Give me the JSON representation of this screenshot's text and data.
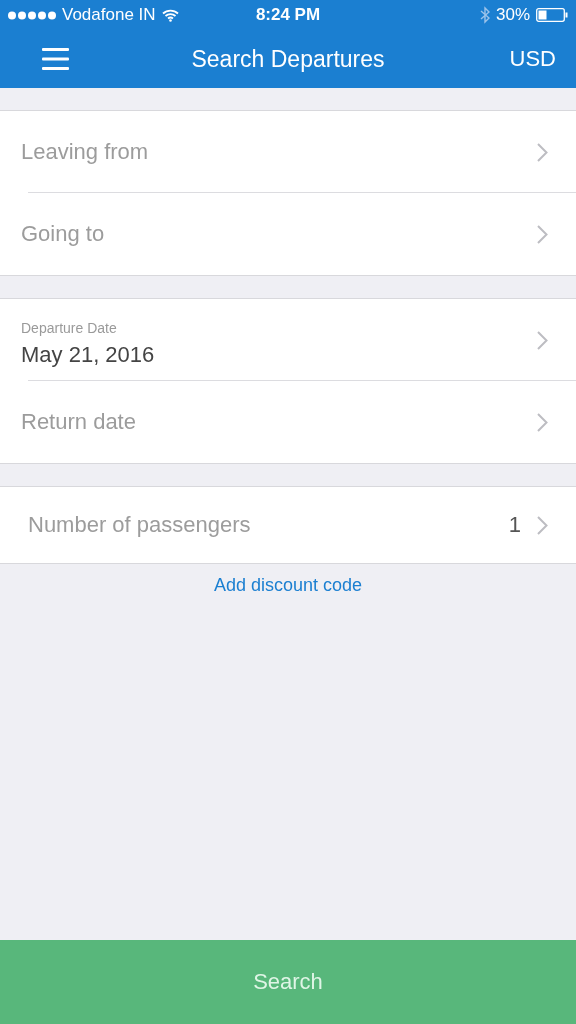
{
  "status_bar": {
    "carrier": "Vodafone IN",
    "time": "8:24 PM",
    "battery": "30%"
  },
  "nav": {
    "title": "Search Departures",
    "currency": "USD"
  },
  "groups": [
    {
      "rows": [
        {
          "kind": "placeholder",
          "text": "Leaving from"
        },
        {
          "kind": "placeholder",
          "text": "Going to"
        }
      ]
    },
    {
      "rows": [
        {
          "kind": "value",
          "label": "Departure Date",
          "text": "May 21, 2016"
        },
        {
          "kind": "placeholder",
          "text": "Return date"
        }
      ]
    },
    {
      "rows": [
        {
          "kind": "count",
          "text": "Number of passengers",
          "value": "1"
        }
      ]
    }
  ],
  "discount_link": "Add discount code",
  "search_button": {
    "label": "Search",
    "disabled": true
  }
}
